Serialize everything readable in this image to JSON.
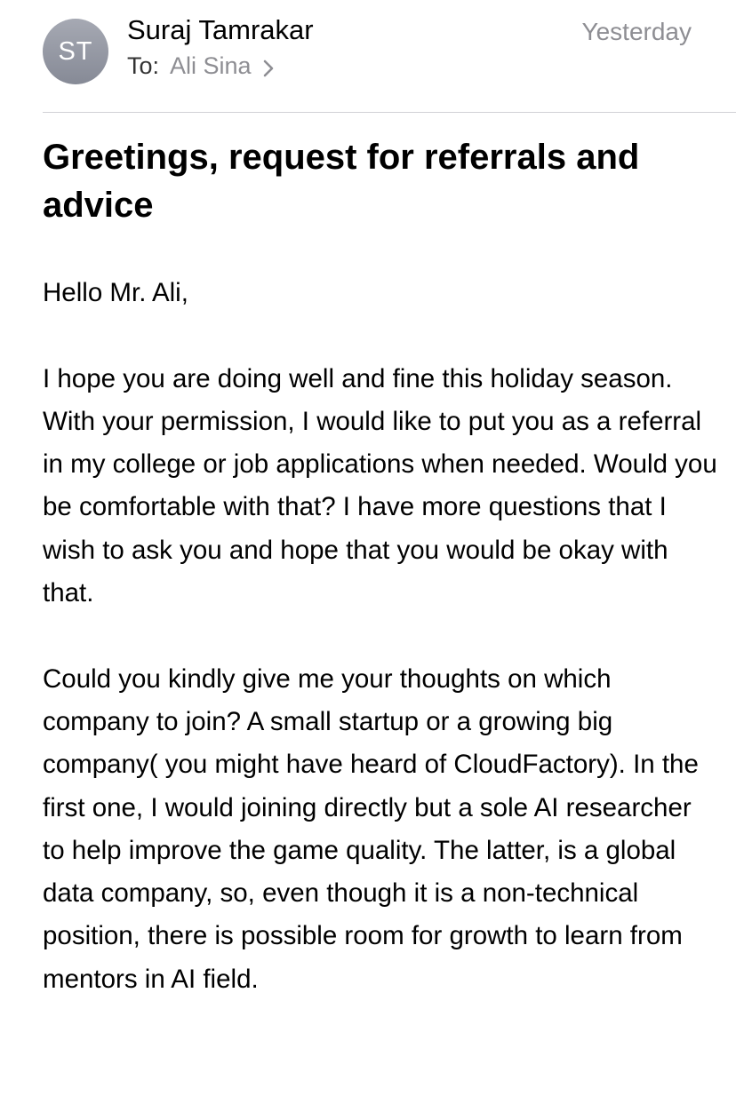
{
  "header": {
    "avatar_initials": "ST",
    "sender_name": "Suraj Tamrakar",
    "to_label": "To:",
    "recipient_name": "Ali Sina",
    "date": "Yesterday"
  },
  "email": {
    "subject": "Greetings, request for referrals and advice",
    "greeting": "Hello Mr. Ali,",
    "paragraphs": [
      "I hope you are doing well and fine this holiday season. With your permission, I would like to put you as a referral in my college or job applications when needed. Would you be comfortable with that? I have more questions that I wish to ask you and hope that you would be okay with that.",
      "Could you kindly give me your thoughts on which company to join? A small startup or a growing big company( you might have heard of CloudFactory). In the first one, I would joining directly but a sole AI researcher to help improve the game quality. The latter, is a global data company, so, even though it is a non-technical position, there is possible room for growth to learn from mentors in AI field."
    ]
  },
  "icons": {
    "recipient_chevron": "chevron-right-icon"
  },
  "colors": {
    "secondary_text": "#8e8e93",
    "divider": "#d1d1d6",
    "avatar_bg": "#969aa5"
  }
}
